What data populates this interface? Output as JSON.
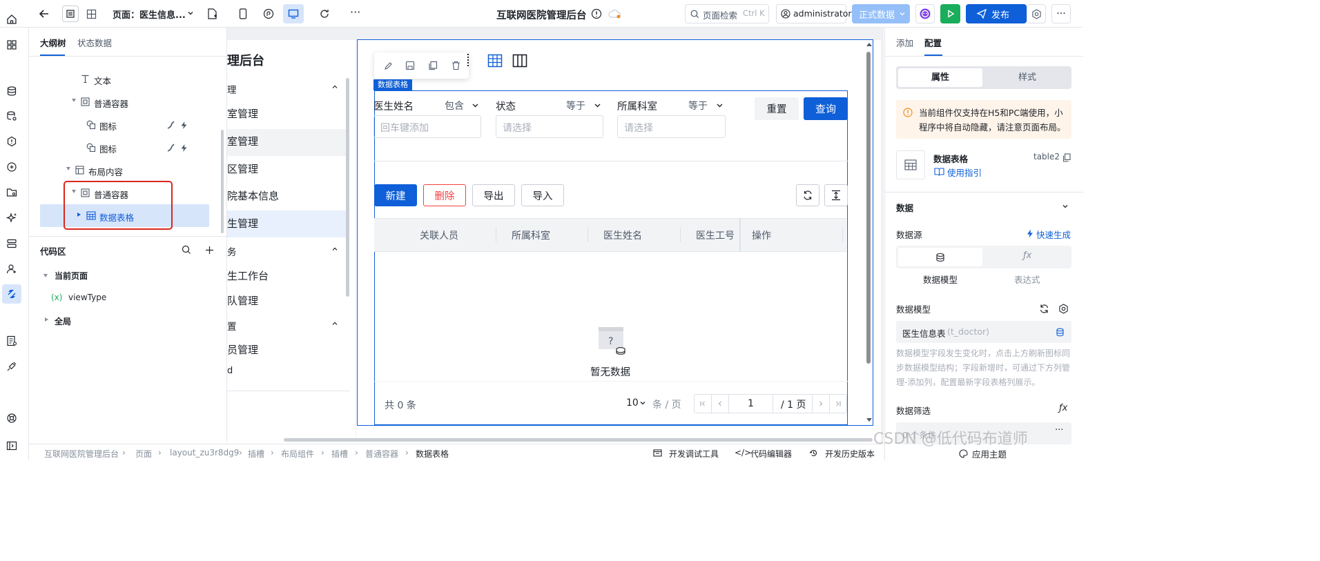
{
  "colors": {
    "primary": "#0e5fd8",
    "accent_teal": "#1aad5c",
    "warning": "#f58a1f",
    "danger": "#f53f3f",
    "blue_selected": "#d7e5fb"
  },
  "topbar": {
    "page_label": "页面：医生信息...",
    "app_title": "互联网医院管理后台",
    "search_placeholder": "页面检索",
    "search_shortcut": "Ctrl K",
    "user": "administrator",
    "env_label": "正式数据",
    "publish_label": "发布",
    "more": "···"
  },
  "left_panel": {
    "tabs": [
      "大纲树",
      "状态数据"
    ],
    "tree": [
      {
        "label": "文本",
        "indent": 2
      },
      {
        "label": "普通容器",
        "indent": 1
      },
      {
        "label": "图标",
        "indent": 2
      },
      {
        "label": "图标",
        "indent": 2
      },
      {
        "label": "布局内容",
        "indent": 0
      },
      {
        "label": "普通容器",
        "indent": 1
      },
      {
        "label": "数据表格",
        "indent": 2
      }
    ],
    "code_title": "代码区",
    "code_items": [
      {
        "label": "当前页面"
      },
      {
        "label": "viewType",
        "prefix": "(x)"
      },
      {
        "label": "全局"
      }
    ]
  },
  "sidemenu": {
    "title": "理后台",
    "items": [
      "理",
      "室管理",
      "室管理",
      "区管理",
      "院基本信息",
      "生管理",
      "务",
      "生工作台",
      "队管理",
      "置",
      "员管理",
      "d"
    ]
  },
  "toolbar_float": {
    "table_tag": "数据表格"
  },
  "filter": {
    "fields": [
      {
        "label": "医生姓名",
        "op": "包含",
        "placeholder": "回车键添加"
      },
      {
        "label": "状态",
        "op": "等于",
        "placeholder": "请选择"
      },
      {
        "label": "所属科室",
        "op": "等于",
        "placeholder": "请选择"
      }
    ],
    "reset": "重置",
    "query": "查询"
  },
  "actions": {
    "new": "新建",
    "delete": "删除",
    "export": "导出",
    "import": "导入"
  },
  "table": {
    "columns": [
      "关联人员",
      "所属科室",
      "医生姓名",
      "医生工号",
      "操作"
    ],
    "empty_text": "暂无数据"
  },
  "pagination": {
    "total": "共 0 条",
    "page_size": "10",
    "per_page": "条 / 页",
    "current": "1",
    "total_pages": "/ 1 页"
  },
  "right_panel": {
    "tabs": [
      "添加",
      "配置"
    ],
    "seg": [
      "属性",
      "样式"
    ],
    "notice": "当前组件仅支持在H5和PC端使用，小程序中将自动隐藏，请注意页面布局。",
    "component_name": "数据表格",
    "component_id": "table2",
    "guide": "使用指引",
    "data_title": "数据",
    "datasource_label": "数据源",
    "quick_gen": "快速生成",
    "ds_options": [
      "数据模型",
      "表达式"
    ],
    "model_label": "数据模型",
    "model_value": "医生信息表",
    "model_value_sub": "(t_doctor)",
    "model_hint": "数据模型字段发生变化时，点击上方刷新图标同步数据模型结构；字段新增时，可通过下方列管理-添加列，配置最新字段表格列展示。",
    "filter_label": "数据筛选",
    "filter_value": "0 个条件",
    "theme": "应用主题"
  },
  "statusbar": {
    "crumbs": [
      "互联网医院管理后台",
      "页面",
      "layout_zu3r8dg9",
      "插槽",
      "布局组件",
      "插槽",
      "普通容器",
      "数据表格"
    ],
    "tools": [
      "开发调试工具",
      "代码编辑器",
      "开发历史版本"
    ]
  },
  "watermark": "CSDN @低代码布道师"
}
